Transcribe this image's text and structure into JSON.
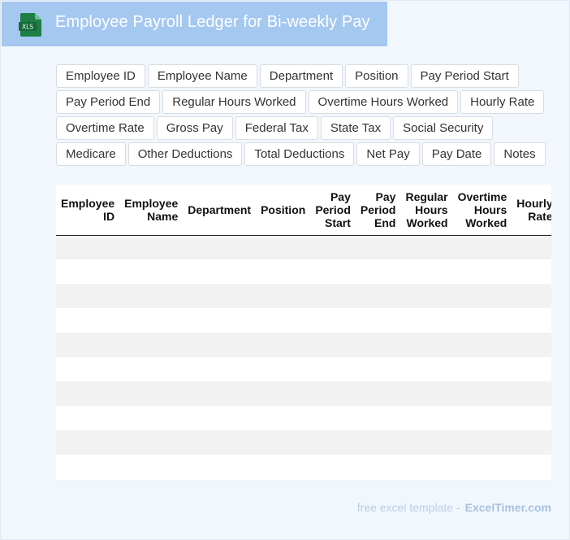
{
  "header": {
    "icon_label": "XLS",
    "title": "Employee Payroll Ledger for Bi-weekly Pay"
  },
  "chips": [
    "Employee ID",
    "Employee Name",
    "Department",
    "Position",
    "Pay Period Start",
    "Pay Period End",
    "Regular Hours Worked",
    "Overtime Hours Worked",
    "Hourly Rate",
    "Overtime Rate",
    "Gross Pay",
    "Federal Tax",
    "State Tax",
    "Social Security",
    "Medicare",
    "Other Deductions",
    "Total Deductions",
    "Net Pay",
    "Pay Date",
    "Notes"
  ],
  "table": {
    "columns": [
      [
        "Employee",
        "ID"
      ],
      [
        "Employee",
        "Name"
      ],
      [
        "Department"
      ],
      [
        "Position"
      ],
      [
        "Pay",
        "Period",
        "Start"
      ],
      [
        "Pay",
        "Period",
        "End"
      ],
      [
        "Regular",
        "Hours",
        "Worked"
      ],
      [
        "Overtime",
        "Hours",
        "Worked"
      ],
      [
        "Hourly",
        "Rate"
      ]
    ],
    "row_count": 10
  },
  "footer": {
    "prefix": "free excel template -",
    "brand": "ExcelTimer.com"
  },
  "colors": {
    "header_bg": "#a4c8f0",
    "page_bg": "#f2f7fd",
    "icon_green": "#1e7e45"
  }
}
